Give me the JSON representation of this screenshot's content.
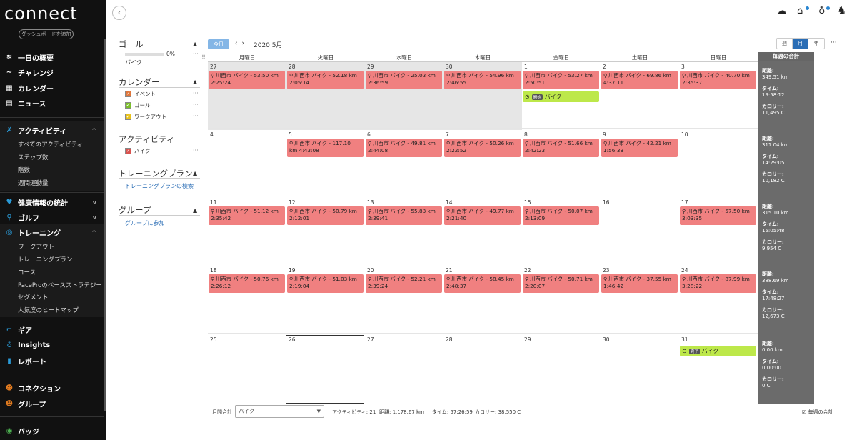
{
  "sidebar": {
    "logo": "connect",
    "dashboard_add": "ダッシュボードを追加",
    "nav": [
      {
        "label": "一日の概要",
        "icon": "layers-icon"
      },
      {
        "label": "チャレンジ",
        "icon": "challenge-icon"
      },
      {
        "label": "カレンダー",
        "icon": "calendar-icon"
      },
      {
        "label": "ニュース",
        "icon": "news-icon"
      }
    ],
    "activity_section": {
      "label": "アクティビティ",
      "items": [
        "すべてのアクティビティ",
        "ステップ数",
        "階数",
        "週間運動量"
      ]
    },
    "health": "健康情報の統計",
    "golf": "ゴルフ",
    "training_section": {
      "label": "トレーニング",
      "items": [
        "ワークアウト",
        "トレーニングプラン",
        "コース",
        "PaceProのペースストラテジー",
        "セグメント",
        "人気度のヒートマップ"
      ]
    },
    "gear": "ギア",
    "insights": "Insights",
    "reports": "レポート",
    "connections": "コネクション",
    "groups": "グループ",
    "badges": "バッジ"
  },
  "left_panel": {
    "goal_title": "ゴール",
    "goal_percent": "0%",
    "goal_progress": 0,
    "goal_name": "バイク",
    "calendar_title": "カレンダー",
    "calendar_items": [
      {
        "label": "イベント",
        "color": "#e0763a"
      },
      {
        "label": "ゴール",
        "color": "#7bbf2a"
      },
      {
        "label": "ワークアウト",
        "color": "#e8c21a"
      }
    ],
    "activity_title": "アクティビティ",
    "activity_items": [
      {
        "label": "バイク",
        "color": "#d9534f"
      }
    ],
    "training_title": "トレーニングプラン",
    "training_link": "トレーニングプランの検索",
    "group_title": "グループ",
    "group_link": "グループに参加"
  },
  "toolbar": {
    "today": "今日",
    "month_title": "2020 5月",
    "views": [
      "週",
      "月",
      "年"
    ],
    "active_view": "月"
  },
  "days": [
    "月曜日",
    "火曜日",
    "水曜日",
    "木曜日",
    "金曜日",
    "土曜日",
    "日曜日"
  ],
  "weekly_header": "毎週の合計",
  "weeks": [
    {
      "dates": [
        "27",
        "28",
        "29",
        "30",
        "1",
        "2",
        "3"
      ],
      "acts": [
        {
          "col": 0,
          "l1": "川西市 バイク - 53.50 km",
          "l2": "2:25:24"
        },
        {
          "col": 1,
          "l1": "川西市 バイク - 52.18 km",
          "l2": "2:05:14"
        },
        {
          "col": 2,
          "l1": "川西市 バイク - 25.03 km",
          "l2": "2:36:59"
        },
        {
          "col": 3,
          "l1": "川西市 バイク - 54.96 km",
          "l2": "2:46:55"
        },
        {
          "col": 4,
          "l1": "川西市 バイク - 53.27 km",
          "l2": "2:50:51"
        },
        {
          "col": 5,
          "l1": "川西市 バイク - 69.86 km",
          "l2": "4:37:11"
        },
        {
          "col": 6,
          "l1": "川西市 バイク - 40.70 km",
          "l2": "2:35:37"
        }
      ],
      "summary": {
        "distance": "349.51 km",
        "time": "19:58:12",
        "calories": "11,495 C"
      }
    },
    {
      "dates": [
        "4",
        "5",
        "6",
        "7",
        "8",
        "9",
        "10"
      ],
      "acts": [
        {
          "col": 1,
          "l1": "川西市 バイク - 117.10",
          "l2": "km 4:43:08"
        },
        {
          "col": 2,
          "l1": "川西市 バイク - 49.81 km",
          "l2": "2:44:08"
        },
        {
          "col": 3,
          "l1": "川西市 バイク - 50.26 km",
          "l2": "2:22:52"
        },
        {
          "col": 4,
          "l1": "川西市 バイク - 51.66 km",
          "l2": "2:42:23"
        },
        {
          "col": 5,
          "l1": "川西市 バイク - 42.21 km",
          "l2": "1:56:33"
        }
      ],
      "summary": {
        "distance": "311.04 km",
        "time": "14:29:05",
        "calories": "10,182 C"
      }
    },
    {
      "dates": [
        "11",
        "12",
        "13",
        "14",
        "15",
        "16",
        "17"
      ],
      "acts": [
        {
          "col": 0,
          "l1": "川西市 バイク - 51.12 km",
          "l2": "2:35:42"
        },
        {
          "col": 1,
          "l1": "川西市 バイク - 50.79 km",
          "l2": "2:12:01"
        },
        {
          "col": 2,
          "l1": "川西市 バイク - 55.83 km",
          "l2": "2:39:41"
        },
        {
          "col": 3,
          "l1": "川西市 バイク - 49.77 km",
          "l2": "2:21:40"
        },
        {
          "col": 4,
          "l1": "川西市 バイク - 50.07 km",
          "l2": "2:13:09"
        },
        {
          "col": 6,
          "l1": "川西市 バイク - 57.50 km",
          "l2": "3:03:35"
        }
      ],
      "summary": {
        "distance": "315.10 km",
        "time": "15:05:48",
        "calories": "9,954 C"
      }
    },
    {
      "dates": [
        "18",
        "19",
        "20",
        "21",
        "22",
        "23",
        "24"
      ],
      "acts": [
        {
          "col": 0,
          "l1": "川西市 バイク - 50.76 km",
          "l2": "2:26:12"
        },
        {
          "col": 1,
          "l1": "川西市 バイク - 51.03 km",
          "l2": "2:19:04"
        },
        {
          "col": 2,
          "l1": "川西市 バイク - 52.21 km",
          "l2": "2:39:24"
        },
        {
          "col": 3,
          "l1": "川西市 バイク - 58.45 km",
          "l2": "2:48:37"
        },
        {
          "col": 4,
          "l1": "川西市 バイク - 50.71 km",
          "l2": "2:20:07"
        },
        {
          "col": 5,
          "l1": "川西市 バイク - 37.55 km",
          "l2": "1:46:42"
        },
        {
          "col": 6,
          "l1": "川西市 バイク - 87.99 km",
          "l2": "3:28:22"
        }
      ],
      "summary": {
        "distance": "388.69 km",
        "time": "17:48:27",
        "calories": "12,673 C"
      }
    },
    {
      "dates": [
        "25",
        "26",
        "27",
        "28",
        "29",
        "30",
        "31"
      ],
      "acts": [],
      "summary": {
        "distance": "0.00 km",
        "time": "0:00:00",
        "calories": "0 C"
      }
    }
  ],
  "goals": [
    {
      "week": 0,
      "col": 4,
      "tag": "開始",
      "label": "バイク"
    },
    {
      "week": 4,
      "col": 6,
      "tag": "完了",
      "label": "バイク"
    }
  ],
  "summary_labels": {
    "distance": "距離:",
    "time": "タイム:",
    "calories": "カロリー:"
  },
  "bottom": {
    "month_total": "月間合計",
    "select_value": "バイク",
    "activities": "アクティビティ: 21",
    "distance": "距離: 1,178.67 km",
    "time": "タイム: 57:26:59",
    "calories": "カロリー: 38,550 C",
    "weekly_total": "毎週の合計"
  }
}
